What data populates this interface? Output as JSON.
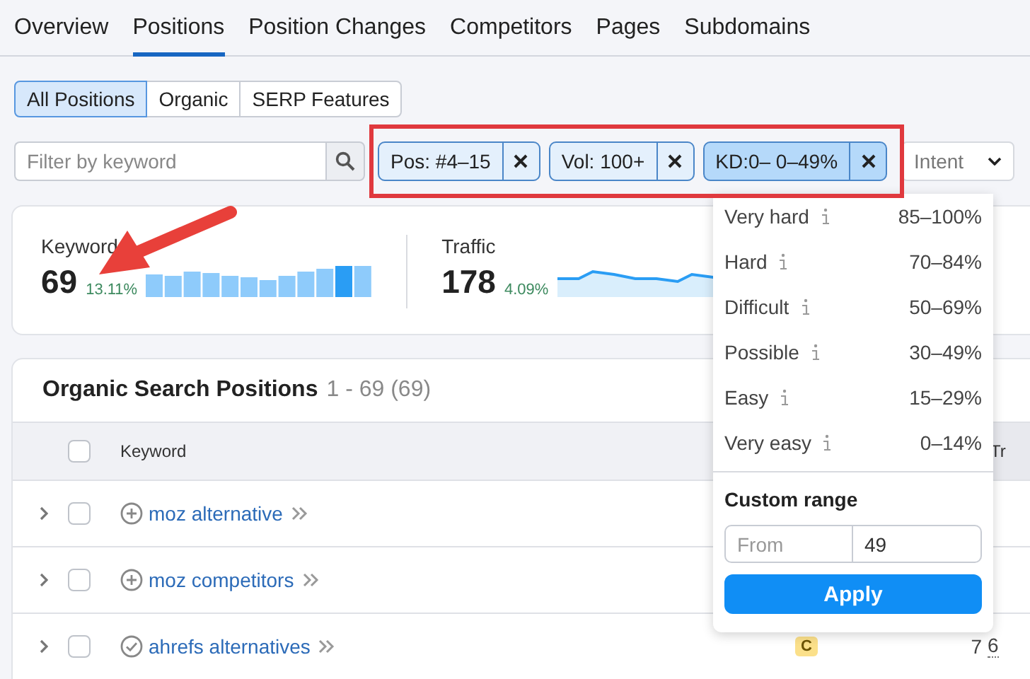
{
  "nav_tabs": [
    {
      "label": "Overview",
      "selected": false
    },
    {
      "label": "Positions",
      "selected": true
    },
    {
      "label": "Position Changes",
      "selected": false
    },
    {
      "label": "Competitors",
      "selected": false
    },
    {
      "label": "Pages",
      "selected": false
    },
    {
      "label": "Subdomains",
      "selected": false
    }
  ],
  "view_segments": [
    {
      "label": "All Positions",
      "selected": true
    },
    {
      "label": "Organic",
      "selected": false
    },
    {
      "label": "SERP Features",
      "selected": false
    }
  ],
  "search": {
    "placeholder": "Filter by keyword"
  },
  "filter_chips": [
    {
      "label": "Pos: #4–15",
      "selected": false
    },
    {
      "label": "Vol: 100+",
      "selected": false
    },
    {
      "label": "KD:0– 0–49%",
      "selected": true
    }
  ],
  "intent_dropdown": {
    "label": "Intent"
  },
  "summary": [
    {
      "kind": "bars",
      "label": "Keyword",
      "value": "69",
      "change": "13.11%"
    },
    {
      "kind": "line",
      "label": "Traffic",
      "value": "178",
      "change": "4.09%"
    }
  ],
  "table": {
    "title": "Organic Search Positions",
    "range": "1 - 69 (69)",
    "columns": [
      "Keyword",
      "Tr"
    ],
    "header_checked": false,
    "rows": [
      {
        "keyword": "moz alternative",
        "kind": "add",
        "checked": false
      },
      {
        "keyword": "moz competitors",
        "kind": "add",
        "checked": false
      },
      {
        "keyword": "ahrefs alternatives",
        "kind": "added",
        "checked": false,
        "intent": "C",
        "column_3": "7",
        "column_4": "6"
      }
    ]
  },
  "kd_menu": {
    "options": [
      {
        "label": "Very hard",
        "range": "85–100%"
      },
      {
        "label": "Hard",
        "range": "70–84%"
      },
      {
        "label": "Difficult",
        "range": "50–69%"
      },
      {
        "label": "Possible",
        "range": "30–49%"
      },
      {
        "label": "Easy",
        "range": "15–29%"
      },
      {
        "label": "Very easy",
        "range": "0–14%"
      }
    ],
    "custom_title": "Custom range",
    "from": {
      "placeholder": "From"
    },
    "to": {
      "value": "49"
    },
    "button": "Apply"
  }
}
